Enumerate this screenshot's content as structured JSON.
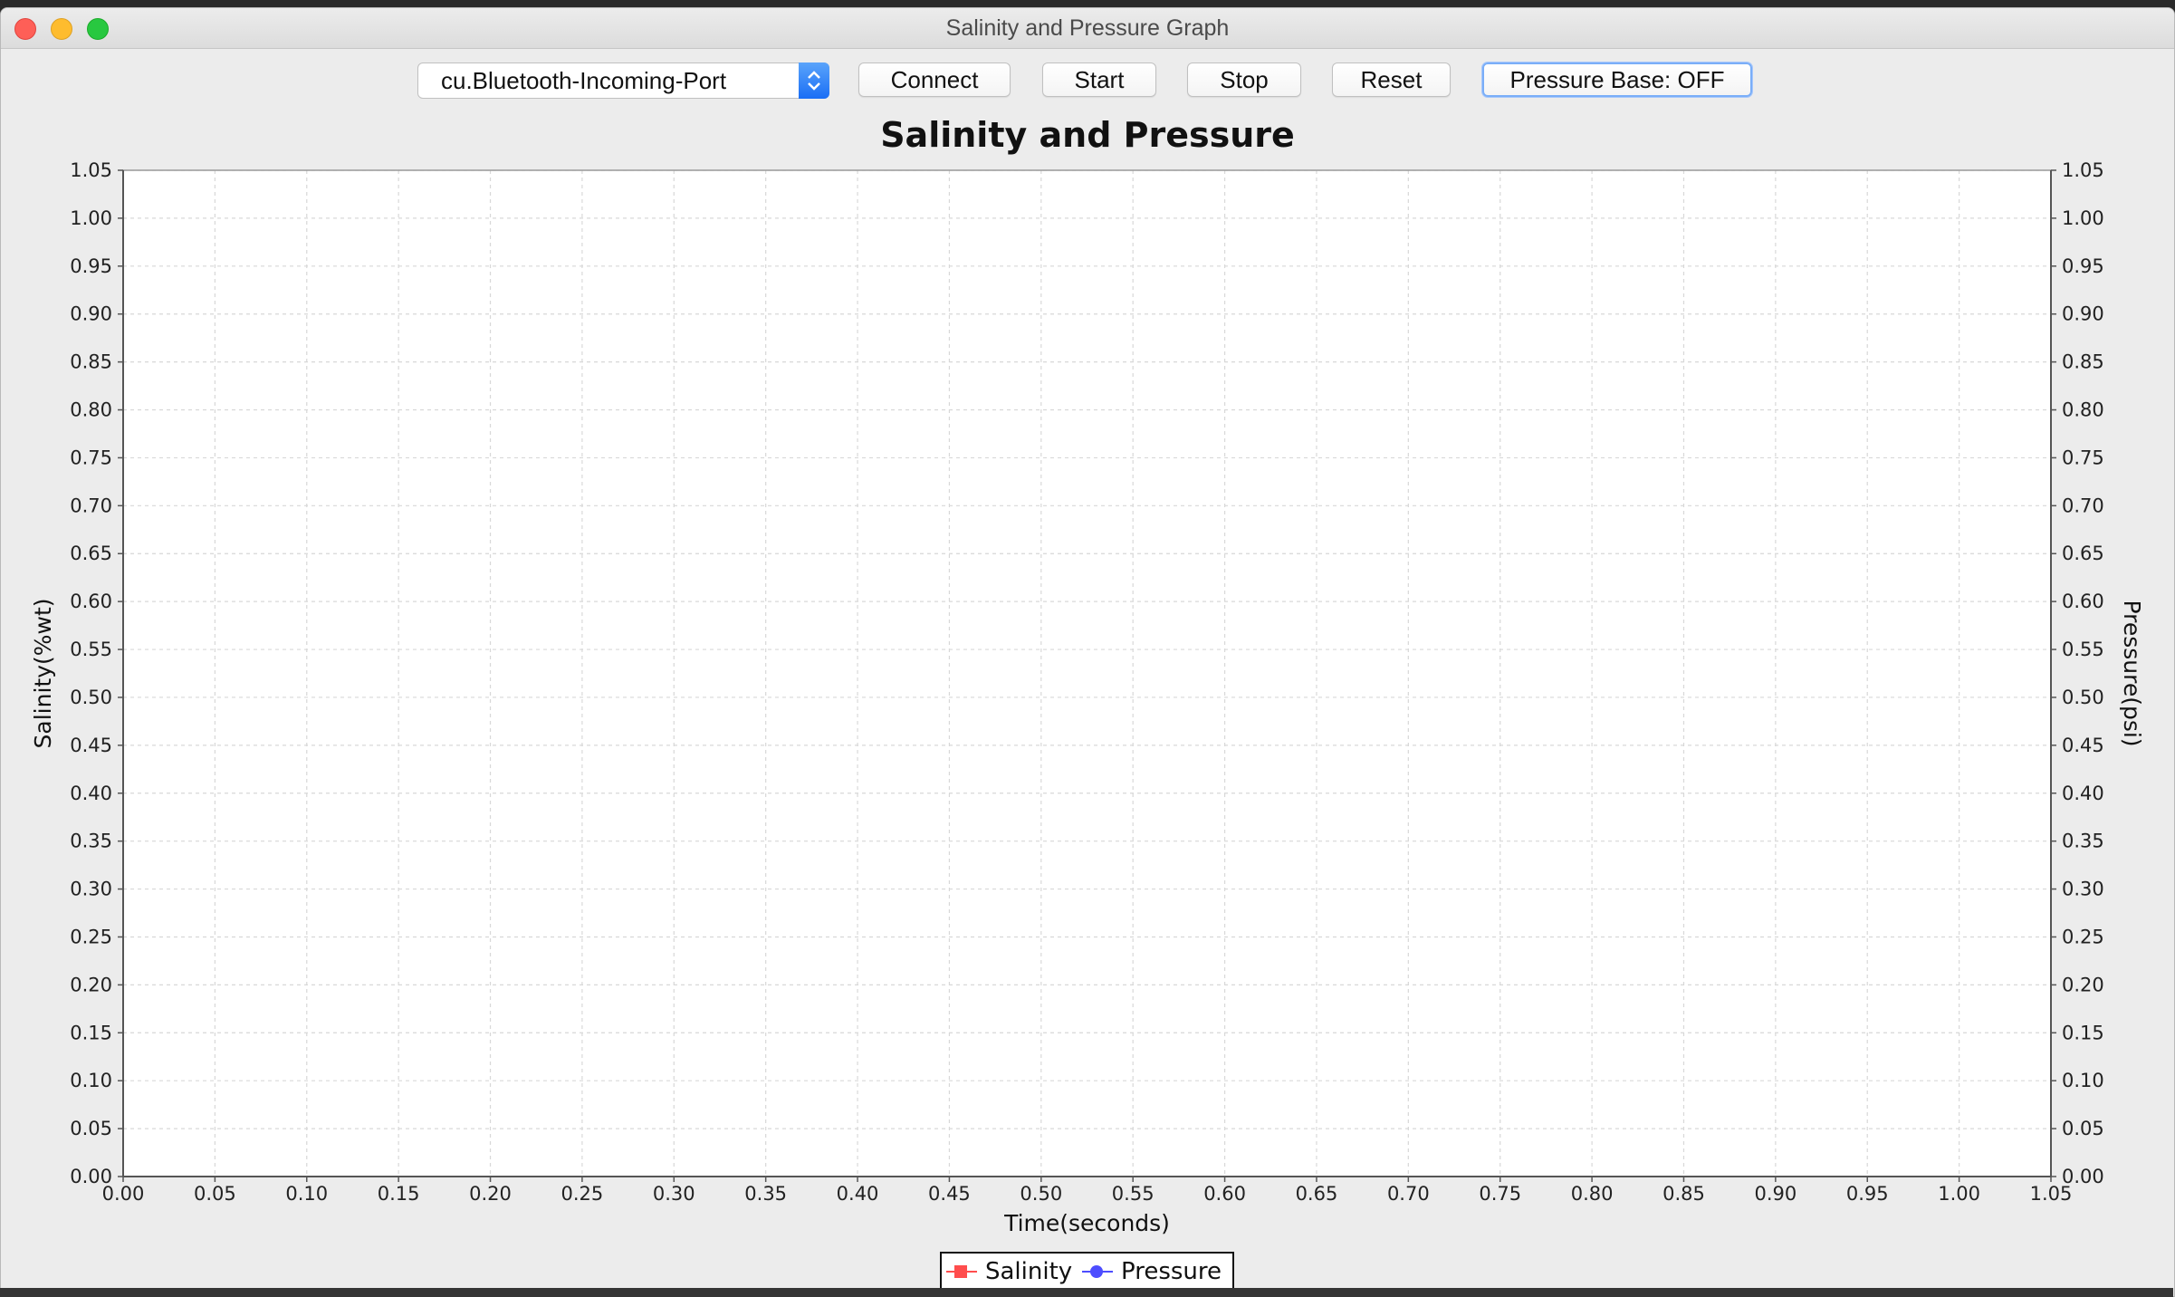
{
  "window": {
    "title": "Salinity and Pressure Graph"
  },
  "toolbar": {
    "port_select": {
      "value": "cu.Bluetooth-Incoming-Port"
    },
    "connect_label": "Connect",
    "start_label": "Start",
    "stop_label": "Stop",
    "reset_label": "Reset",
    "pressure_base_label": "Pressure Base: OFF"
  },
  "chart_data": {
    "type": "line",
    "title": "Salinity and Pressure",
    "xlabel": "Time(seconds)",
    "ylabel": "Salinity(%wt)",
    "y2label": "Pressure(psi)",
    "xlim": [
      0.0,
      1.05
    ],
    "ylim": [
      0.0,
      1.05
    ],
    "y2lim": [
      0.0,
      1.05
    ],
    "x_ticks": [
      "0.00",
      "0.05",
      "0.10",
      "0.15",
      "0.20",
      "0.25",
      "0.30",
      "0.35",
      "0.40",
      "0.45",
      "0.50",
      "0.55",
      "0.60",
      "0.65",
      "0.70",
      "0.75",
      "0.80",
      "0.85",
      "0.90",
      "0.95",
      "1.00",
      "1.05"
    ],
    "y_ticks": [
      "0.00",
      "0.05",
      "0.10",
      "0.15",
      "0.20",
      "0.25",
      "0.30",
      "0.35",
      "0.40",
      "0.45",
      "0.50",
      "0.55",
      "0.60",
      "0.65",
      "0.70",
      "0.75",
      "0.80",
      "0.85",
      "0.90",
      "0.95",
      "1.00",
      "1.05"
    ],
    "y2_ticks": [
      "0.00",
      "0.05",
      "0.10",
      "0.15",
      "0.20",
      "0.25",
      "0.30",
      "0.35",
      "0.40",
      "0.45",
      "0.50",
      "0.55",
      "0.60",
      "0.65",
      "0.70",
      "0.75",
      "0.80",
      "0.85",
      "0.90",
      "0.95",
      "1.00",
      "1.05"
    ],
    "grid": true,
    "legend_position": "bottom-center",
    "series": [
      {
        "name": "Salinity",
        "axis": "left",
        "color": "#ff4d4d",
        "marker": "square",
        "x": [],
        "y": []
      },
      {
        "name": "Pressure",
        "axis": "right",
        "color": "#4d4dff",
        "marker": "circle",
        "x": [],
        "y": []
      }
    ]
  }
}
